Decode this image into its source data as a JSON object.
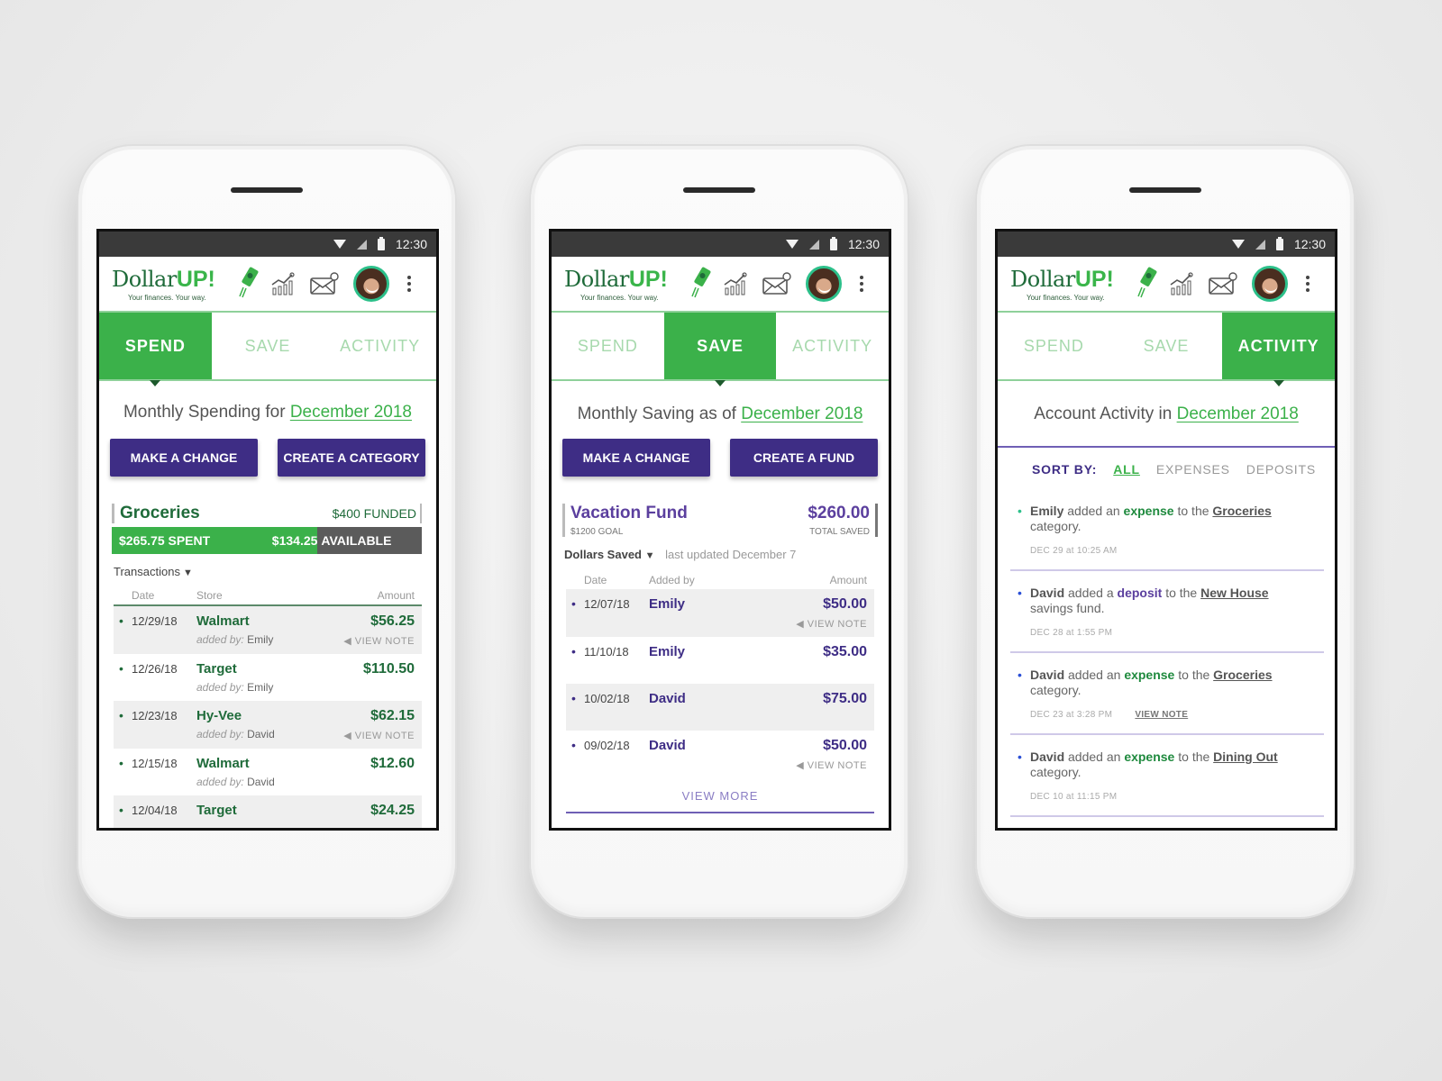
{
  "colors": {
    "brand_green": "#3bb14a",
    "dark_green": "#1f6b3a",
    "brand_purple": "#3e2d85",
    "fund_purple": "#5b3f9e",
    "status_bar": "#3a3a3a"
  },
  "statusbar": {
    "time": "12:30",
    "icons": [
      "wifi-icon",
      "signal-icon",
      "battery-icon"
    ]
  },
  "app": {
    "logo_text_1": "Dollar",
    "logo_text_2": "UP!",
    "tagline": "Your finances. Your way.",
    "icons": [
      "rocket-money-icon",
      "chart-icon",
      "mail-icon",
      "avatar",
      "more-vert-icon"
    ]
  },
  "tabs": [
    "SPEND",
    "SAVE",
    "ACTIVITY"
  ],
  "spend": {
    "active_tab": "SPEND",
    "heading_prefix": "Monthly Spending for",
    "month": "December 2018",
    "buttons": [
      "MAKE A CHANGE",
      "CREATE A CATEGORY"
    ],
    "category": {
      "name": "Groceries",
      "funded": "$400 FUNDED",
      "spent": "$265.75 SPENT",
      "available_amount": "$134.25",
      "available_label": "AVAILABLE",
      "spent_fraction": 0.664
    },
    "dropdown_label": "Transactions",
    "columns": [
      "Date",
      "Store",
      "Amount"
    ],
    "added_by_label": "added by:",
    "view_note": "VIEW NOTE",
    "rows": [
      {
        "date": "12/29/18",
        "store": "Walmart",
        "by": "Emily",
        "amount": "$56.25",
        "note": true
      },
      {
        "date": "12/26/18",
        "store": "Target",
        "by": "Emily",
        "amount": "$110.50",
        "note": false
      },
      {
        "date": "12/23/18",
        "store": "Hy-Vee",
        "by": "David",
        "amount": "$62.15",
        "note": true
      },
      {
        "date": "12/15/18",
        "store": "Walmart",
        "by": "David",
        "amount": "$12.60",
        "note": false
      },
      {
        "date": "12/04/18",
        "store": "Target",
        "by": "",
        "amount": "$24.25",
        "note": false
      }
    ]
  },
  "save": {
    "active_tab": "SAVE",
    "heading_prefix": "Monthly Saving as of",
    "month": "December 2018",
    "buttons": [
      "MAKE A CHANGE",
      "CREATE A FUND"
    ],
    "fund": {
      "name": "Vacation Fund",
      "goal": "$1200 GOAL",
      "total": "$260.00",
      "total_label": "TOTAL SAVED"
    },
    "dropdown_label": "Dollars Saved",
    "last_updated": "last updated December 7",
    "columns": [
      "Date",
      "Added by",
      "Amount"
    ],
    "view_note": "VIEW NOTE",
    "rows": [
      {
        "date": "12/07/18",
        "by": "Emily",
        "amount": "$50.00",
        "note": true
      },
      {
        "date": "11/10/18",
        "by": "Emily",
        "amount": "$35.00",
        "note": false
      },
      {
        "date": "10/02/18",
        "by": "David",
        "amount": "$75.00",
        "note": false
      },
      {
        "date": "09/02/18",
        "by": "David",
        "amount": "$50.00",
        "note": true
      }
    ],
    "view_more": "VIEW MORE"
  },
  "activity": {
    "active_tab": "ACTIVITY",
    "heading_prefix": "Account Activity in",
    "month": "December 2018",
    "sort_label": "SORT BY:",
    "sort_options": [
      "ALL",
      "EXPENSES",
      "DEPOSITS"
    ],
    "sort_selected": "ALL",
    "view_note": "VIEW NOTE",
    "items": [
      {
        "who": "Emily",
        "verb": "added an",
        "kind": "expense",
        "mid": "to the",
        "target": "Groceries",
        "tail": "category.",
        "time": "DEC 29 at 10:25 AM",
        "note": false,
        "dot_color": "#2cc08a"
      },
      {
        "who": "David",
        "verb": "added a",
        "kind": "deposit",
        "mid": "to the",
        "target": "New House",
        "tail": "savings fund.",
        "time": "DEC 28 at 1:55 PM",
        "note": false,
        "dot_color": "#2a4fd6"
      },
      {
        "who": "David",
        "verb": "added an",
        "kind": "expense",
        "mid": "to the",
        "target": "Groceries",
        "tail": "category.",
        "time": "DEC 23 at 3:28 PM",
        "note": true,
        "dot_color": "#2a4fd6"
      },
      {
        "who": "David",
        "verb": "added an",
        "kind": "expense",
        "mid": "to the",
        "target": "Dining Out",
        "tail": "category.",
        "time": "DEC 10 at 11:15 PM",
        "note": false,
        "dot_color": "#2a4fd6"
      }
    ]
  }
}
